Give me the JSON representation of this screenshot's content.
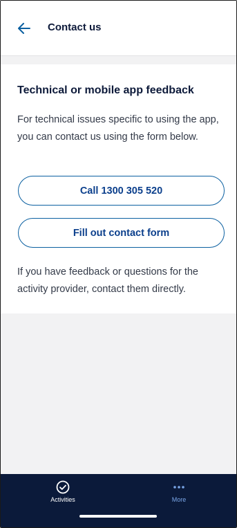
{
  "header": {
    "back_icon": "arrow-left-icon",
    "title": "Contact us"
  },
  "card": {
    "title": "Technical or mobile app feedback",
    "description": "For technical issues specific to using the app, you can contact us using the form below.",
    "call_button_label": "Call 1300 305 520",
    "form_button_label": "Fill out contact form",
    "note": "If you have feedback or questions for the activity provider, contact them directly."
  },
  "tabbar": {
    "items": [
      {
        "label": "Activities",
        "icon": "check-circle-icon",
        "active": false
      },
      {
        "label": "More",
        "icon": "more-dots-icon",
        "active": true
      }
    ]
  },
  "colors": {
    "accent": "#0a5fa0",
    "button_text": "#0b3f8c",
    "title_text": "#0d1a3a",
    "tabbar_bg": "#0b1a3a",
    "tab_active": "#7aa6e8"
  }
}
